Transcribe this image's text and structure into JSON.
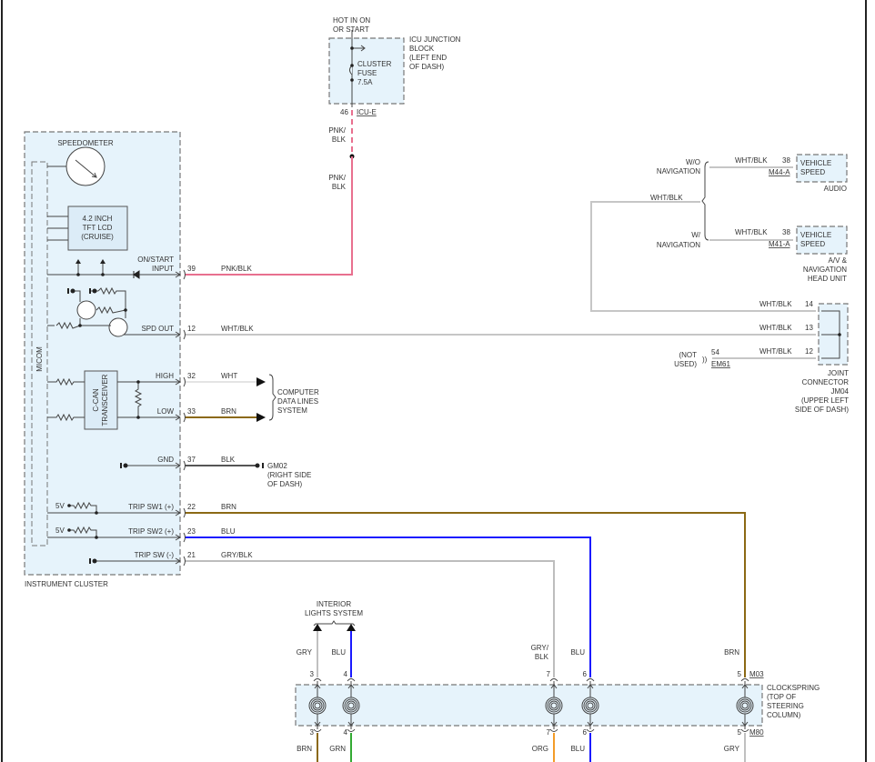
{
  "wire_colors": {
    "PNK/BLK": "#e8708f",
    "WHT/BLK": "#c6c6c6",
    "WHT": "#e4e4e4",
    "BRN": "#8b6914",
    "BLK": "#555555",
    "BLU": "#1a1aff",
    "GRY/BLK": "#bdbdbd",
    "GRY": "#c0c0c0",
    "GRN": "#33aa33",
    "ORG": "#f39c28",
    "box_fill": "#e6f3fb"
  },
  "fuse": {
    "hot": [
      "HOT IN ON",
      "OR START"
    ],
    "block": [
      "ICU JUNCTION",
      "BLOCK",
      "(LEFT END",
      "OF DASH)"
    ],
    "name": [
      "CLUSTER",
      "FUSE",
      "7.5A"
    ],
    "pin": "46",
    "connector": "ICU-E",
    "wire1": [
      "PNK/",
      "BLK"
    ],
    "wire2": [
      "PNK/",
      "BLK"
    ]
  },
  "cluster": {
    "title": "INSTRUMENT CLUSTER",
    "speedometer": "SPEEDOMETER",
    "micom": "MICOM",
    "lcd": [
      "4.2 INCH",
      "TFT LCD",
      "(CRUISE)"
    ],
    "transceiver": [
      "C-CAN",
      "TRANSCEIVER"
    ],
    "fivev": "5V",
    "pins": [
      {
        "label": [
          "ON/START",
          "INPUT"
        ],
        "pin": "39",
        "wire": "PNK/BLK"
      },
      {
        "label": [
          "SPD OUT"
        ],
        "pin": "12",
        "wire": "WHT/BLK"
      },
      {
        "label": [
          "HIGH"
        ],
        "pin": "32",
        "wire": "WHT"
      },
      {
        "label": [
          "LOW"
        ],
        "pin": "33",
        "wire": "BRN"
      },
      {
        "label": [
          "GND"
        ],
        "pin": "37",
        "wire": "BLK"
      },
      {
        "label": [
          "TRIP SW1 (+)"
        ],
        "pin": "22",
        "wire": "BRN"
      },
      {
        "label": [
          "TRIP SW2 (+)"
        ],
        "pin": "23",
        "wire": "BLU"
      },
      {
        "label": [
          "TRIP SW (-)"
        ],
        "pin": "21",
        "wire": "GRY/BLK"
      }
    ]
  },
  "data_lines": [
    "COMPUTER",
    "DATA LINES",
    "SYSTEM"
  ],
  "ground": [
    "GM02",
    "(RIGHT SIDE",
    "OF DASH)"
  ],
  "nav": {
    "wire": "WHT/BLK",
    "wo": {
      "label": [
        "W/O",
        "NAVIGATION"
      ],
      "wire": "WHT/BLK",
      "pin": "38",
      "connector": "M44-A",
      "box": [
        "VEHICLE",
        "SPEED"
      ],
      "unit": [
        "AUDIO"
      ]
    },
    "w": {
      "label": [
        "W/",
        "NAVIGATION"
      ],
      "wire": "WHT/BLK",
      "pin": "38",
      "connector": "M41-A",
      "box": [
        "VEHICLE",
        "SPEED"
      ],
      "unit": [
        "A/V &",
        "NAVIGATION",
        "HEAD UNIT"
      ]
    }
  },
  "joint": {
    "rows": [
      {
        "wire": "WHT/BLK",
        "pin": "14"
      },
      {
        "wire": "WHT/BLK",
        "pin": "13"
      },
      {
        "wire": "WHT/BLK",
        "pin": "12"
      }
    ],
    "not_used": [
      "(NOT",
      "USED)"
    ],
    "nu_pin": "54",
    "nu_connector": "EM61",
    "label": [
      "JOINT",
      "CONNECTOR",
      "JM04",
      "(UPPER LEFT",
      "SIDE OF DASH)"
    ]
  },
  "interior": [
    "INTERIOR",
    "LIGHTS SYSTEM"
  ],
  "clockspring": {
    "label": [
      "CLOCKSPRING",
      "(TOP OF",
      "STEERING",
      "COLUMN)"
    ],
    "top_connector": "M03",
    "bottom_connector": "M80",
    "circuits": [
      {
        "pin": "3",
        "top": [
          "GRY"
        ],
        "bottom": "BRN"
      },
      {
        "pin": "4",
        "top": [
          "BLU"
        ],
        "bottom": "GRN"
      },
      {
        "pin": "7",
        "top": [
          "GRY/",
          "BLK"
        ],
        "bottom": "ORG"
      },
      {
        "pin": "6",
        "top": [
          "BLU"
        ],
        "bottom": "BLU"
      },
      {
        "pin": "5",
        "top": [
          "BRN"
        ],
        "bottom": "GRY"
      }
    ]
  }
}
